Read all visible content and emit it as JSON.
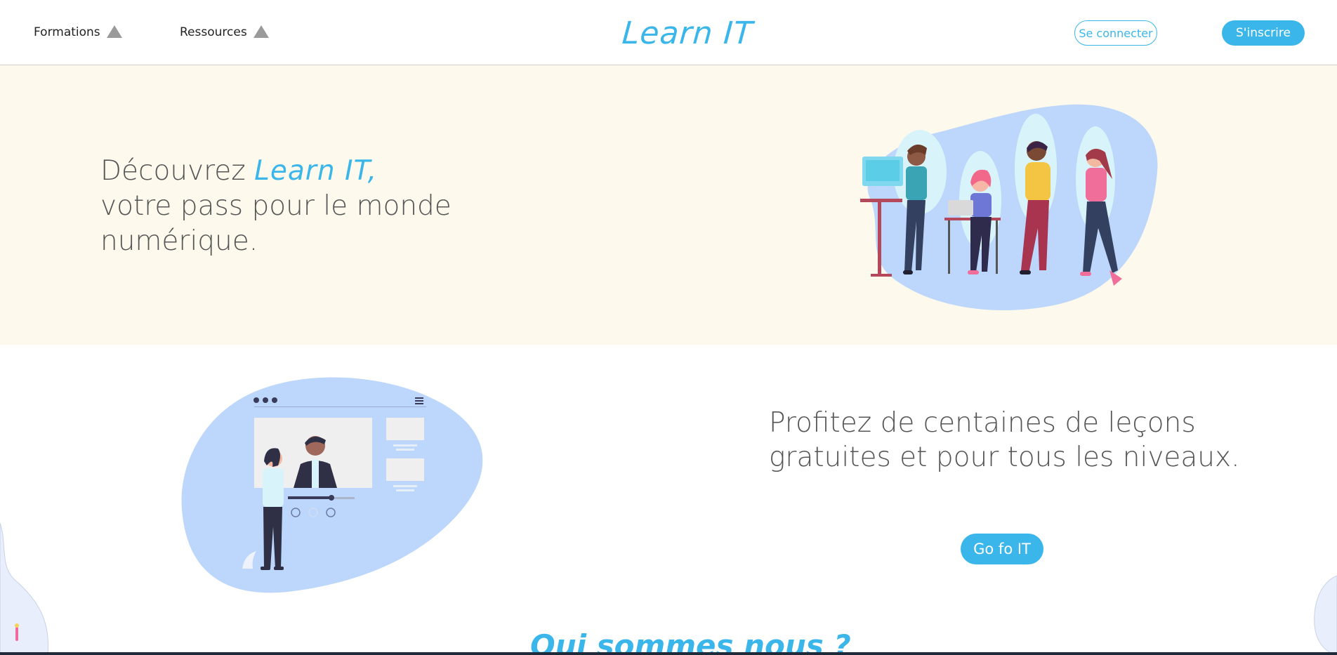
{
  "header": {
    "nav": [
      {
        "label": "Formations",
        "icon": "triangle-up-icon"
      },
      {
        "label": "Ressources",
        "icon": "triangle-up-icon"
      }
    ],
    "logo": "Learn IT",
    "login_label": "Se connecter",
    "signup_label": "S'inscrire"
  },
  "hero": {
    "line1_prefix": "Découvrez ",
    "line1_brand": "Learn IT,",
    "line2": "votre pass pour le monde",
    "line3": "numérique."
  },
  "lessons": {
    "line1": "Profitez de centaines de leçons",
    "line2": "gratuites et pour tous les niveaux.",
    "cta_label": "Go fo IT"
  },
  "about": {
    "title": "Qui sommes nous ?"
  },
  "colors": {
    "accent": "#3bb6ea",
    "hero_bg": "#fdf9ec",
    "blob": "#bcd7fb",
    "text": "#555555"
  }
}
